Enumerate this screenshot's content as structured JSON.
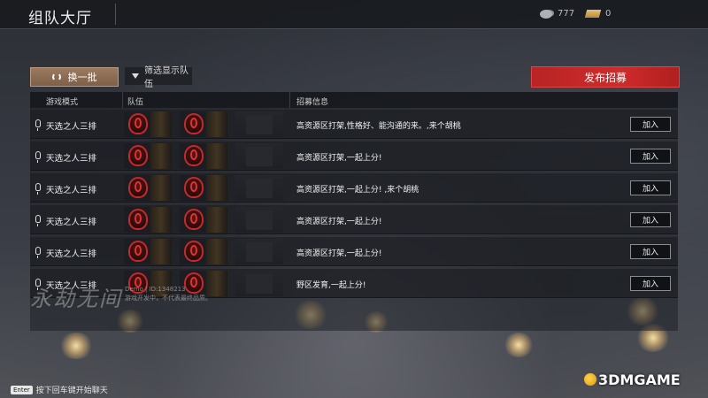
{
  "header": {
    "title": "组队大厅",
    "silver": "777",
    "gold": "0"
  },
  "toolbar": {
    "refresh_label": "换一批",
    "filter_label": "筛选显示队伍",
    "publish_label": "发布招募"
  },
  "table": {
    "columns": [
      "游戏模式",
      "队伍",
      "招募信息"
    ],
    "rows": [
      {
        "mode": "天选之人三排",
        "info": "高资源区打架,性格好、能沟通的来。,来个胡桃",
        "join": "加入"
      },
      {
        "mode": "天选之人三排",
        "info": "高资源区打架,一起上分!",
        "join": "加入"
      },
      {
        "mode": "天选之人三排",
        "info": "高资源区打架,一起上分!  ,来个胡桃",
        "join": "加入"
      },
      {
        "mode": "天选之人三排",
        "info": "高资源区打架,一起上分!",
        "join": "加入"
      },
      {
        "mode": "天选之人三排",
        "info": "高资源区打架,一起上分!",
        "join": "加入"
      },
      {
        "mode": "天选之人三排",
        "info": "野区发育,一起上分!",
        "join": "加入"
      }
    ]
  },
  "overlay": {
    "watermark": "永劫无间",
    "demo_line1": "Demo | ID:1348213",
    "demo_line2": "游戏开发中，不代表最终品质。"
  },
  "footer": {
    "key": "Enter",
    "hint": "按下回车键开始聊天",
    "site_logo": "3DMGAME"
  },
  "colors": {
    "accent_red": "#cf2b2b",
    "refresh_bg": "#8a6c54"
  },
  "icons": [
    "silver-coin-icon",
    "gold-bar-icon",
    "refresh-icon",
    "filter-icon",
    "mic-icon",
    "team-emblem-icon"
  ]
}
